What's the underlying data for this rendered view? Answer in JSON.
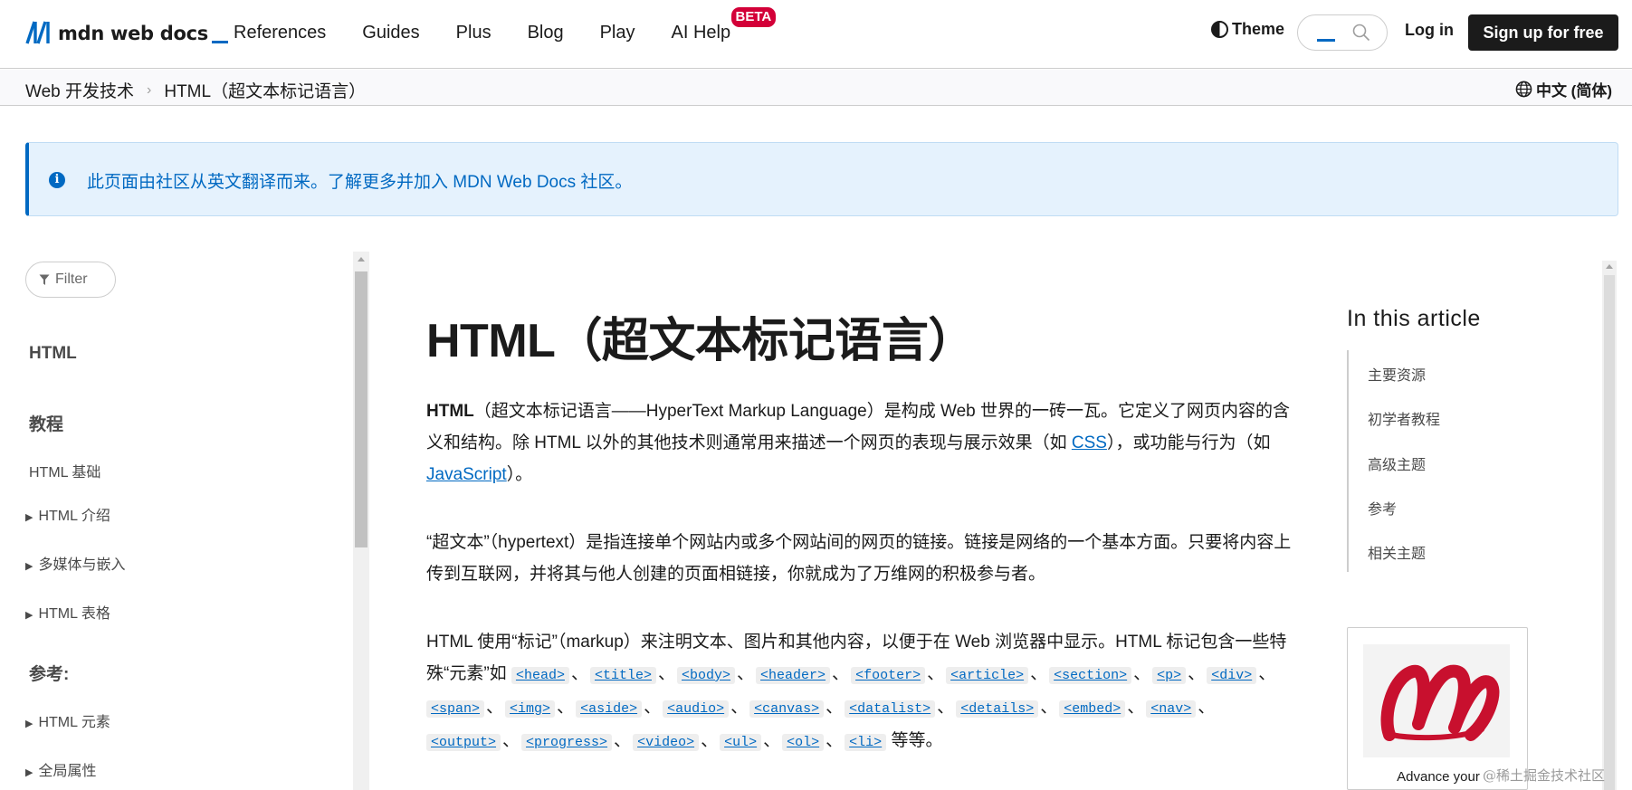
{
  "brand": {
    "logo_text": "mdn web docs",
    "accent": "#0069c2"
  },
  "topnav": {
    "items": [
      "References",
      "Guides",
      "Plus",
      "Blog",
      "Play",
      "AI Help"
    ],
    "beta_badge": "BETA",
    "theme_label": "Theme",
    "login_label": "Log in",
    "signup_label": "Sign up for free"
  },
  "breadcrumb": {
    "items": [
      "Web 开发技术",
      "HTML（超文本标记语言）"
    ],
    "separator": "›",
    "language": "中文 (简体)"
  },
  "notice": {
    "icon": "info-icon",
    "message": "此页面由社区从英文翻译而来。了解更多并加入 MDN Web Docs 社区。"
  },
  "sidebar": {
    "filter_placeholder": "Filter",
    "section_html": "HTML",
    "section_tutorials": "教程",
    "item_basics": "HTML 基础",
    "toggles_tutorials": [
      "HTML 介绍",
      "多媒体与嵌入",
      "HTML 表格"
    ],
    "section_reference": "参考:",
    "toggles_reference": [
      "HTML 元素",
      "全局属性"
    ]
  },
  "article": {
    "title": "HTML（超文本标记语言）",
    "p1_strong": "HTML",
    "p1_a": "（超文本标记语言——HyperText Markup Language）是构成 Web 世界的一砖一瓦。它定义了网页内容的含义和结构。除 HTML 以外的其他技术则通常用来描述一个网页的表现与展示效果（如 ",
    "p1_link_css": "CSS",
    "p1_b": "），或功能与行为（如 ",
    "p1_link_js": "JavaScript",
    "p1_c": "）。",
    "p2": "“超文本”（hypertext）是指连接单个网站内或多个网站间的网页的链接。链接是网络的一个基本方面。只要将内容上传到互联网，并将其与他人创建的页面相链接，你就成为了万维网的积极参与者。",
    "p3_a": "HTML 使用“标记”（markup）来注明文本、图片和其他内容，以便于在 Web 浏览器中显示。HTML 标记包含一些特殊“元素”如 ",
    "p3_tags": [
      "<head>",
      "<title>",
      "<body>",
      "<header>",
      "<footer>",
      "<article>",
      "<section>",
      "<p>",
      "<div>",
      "<span>",
      "<img>",
      "<aside>",
      "<audio>",
      "<canvas>",
      "<datalist>",
      "<details>",
      "<embed>",
      "<nav>",
      "<output>",
      "<progress>",
      "<video>",
      "<ul>",
      "<ol>",
      "<li>"
    ],
    "p3_sep": "、",
    "p3_end": " 等等。"
  },
  "toc": {
    "title": "In this article",
    "items": [
      "主要资源",
      "初学者教程",
      "高级主题",
      "参考",
      "相关主题"
    ]
  },
  "ad": {
    "text": "Advance your"
  },
  "watermark": "@稀土掘金技术社区"
}
